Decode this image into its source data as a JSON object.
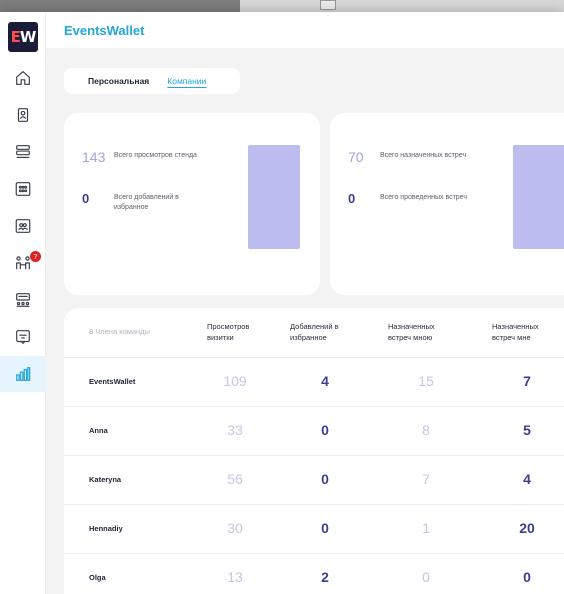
{
  "app": {
    "title": "EventsWallet",
    "logo_text_e": "E",
    "logo_text_w": "W"
  },
  "sidebar": {
    "items": [
      {
        "icon": "home-icon"
      },
      {
        "icon": "badge-icon"
      },
      {
        "icon": "list-icon"
      },
      {
        "icon": "grid-icon"
      },
      {
        "icon": "team-icon"
      },
      {
        "icon": "people-icon",
        "badge": "7"
      },
      {
        "icon": "stand-icon"
      },
      {
        "icon": "chat-icon"
      },
      {
        "icon": "analytics-icon",
        "active": true
      }
    ]
  },
  "tabs": {
    "personal": "Персональная",
    "company": "Компании"
  },
  "stats": {
    "card1": {
      "row1": {
        "value": "143",
        "label": "Всего просмотров стенда"
      },
      "row2": {
        "value": "0",
        "label": "Всего добавлений в избранное"
      }
    },
    "card2": {
      "row1": {
        "value": "70",
        "label": "Всего назначенных встреч"
      },
      "row2": {
        "value": "0",
        "label": "Всего проведенных встреч"
      }
    }
  },
  "table": {
    "members_label": "8 Члена команды",
    "columns": [
      "Просмотров визитки",
      "Добавлений в избранное",
      "Назначенных встреч мною",
      "Назначенных встреч мне"
    ],
    "rows": [
      {
        "name": "EventsWallet",
        "values": [
          "109",
          "4",
          "15",
          "7"
        ]
      },
      {
        "name": "Anna",
        "values": [
          "33",
          "0",
          "8",
          "5"
        ]
      },
      {
        "name": "Kateryna",
        "values": [
          "56",
          "0",
          "7",
          "4"
        ]
      },
      {
        "name": "Hennadiy",
        "values": [
          "30",
          "0",
          "1",
          "20"
        ]
      },
      {
        "name": "Olga",
        "values": [
          "13",
          "2",
          "0",
          "0"
        ]
      }
    ]
  },
  "colors": {
    "accent": "#21a7d8",
    "bar": "#bcbdee",
    "value_dark": "#3a3f8f",
    "value_light": "#c4c6e6",
    "badge": "#e01e1e"
  }
}
